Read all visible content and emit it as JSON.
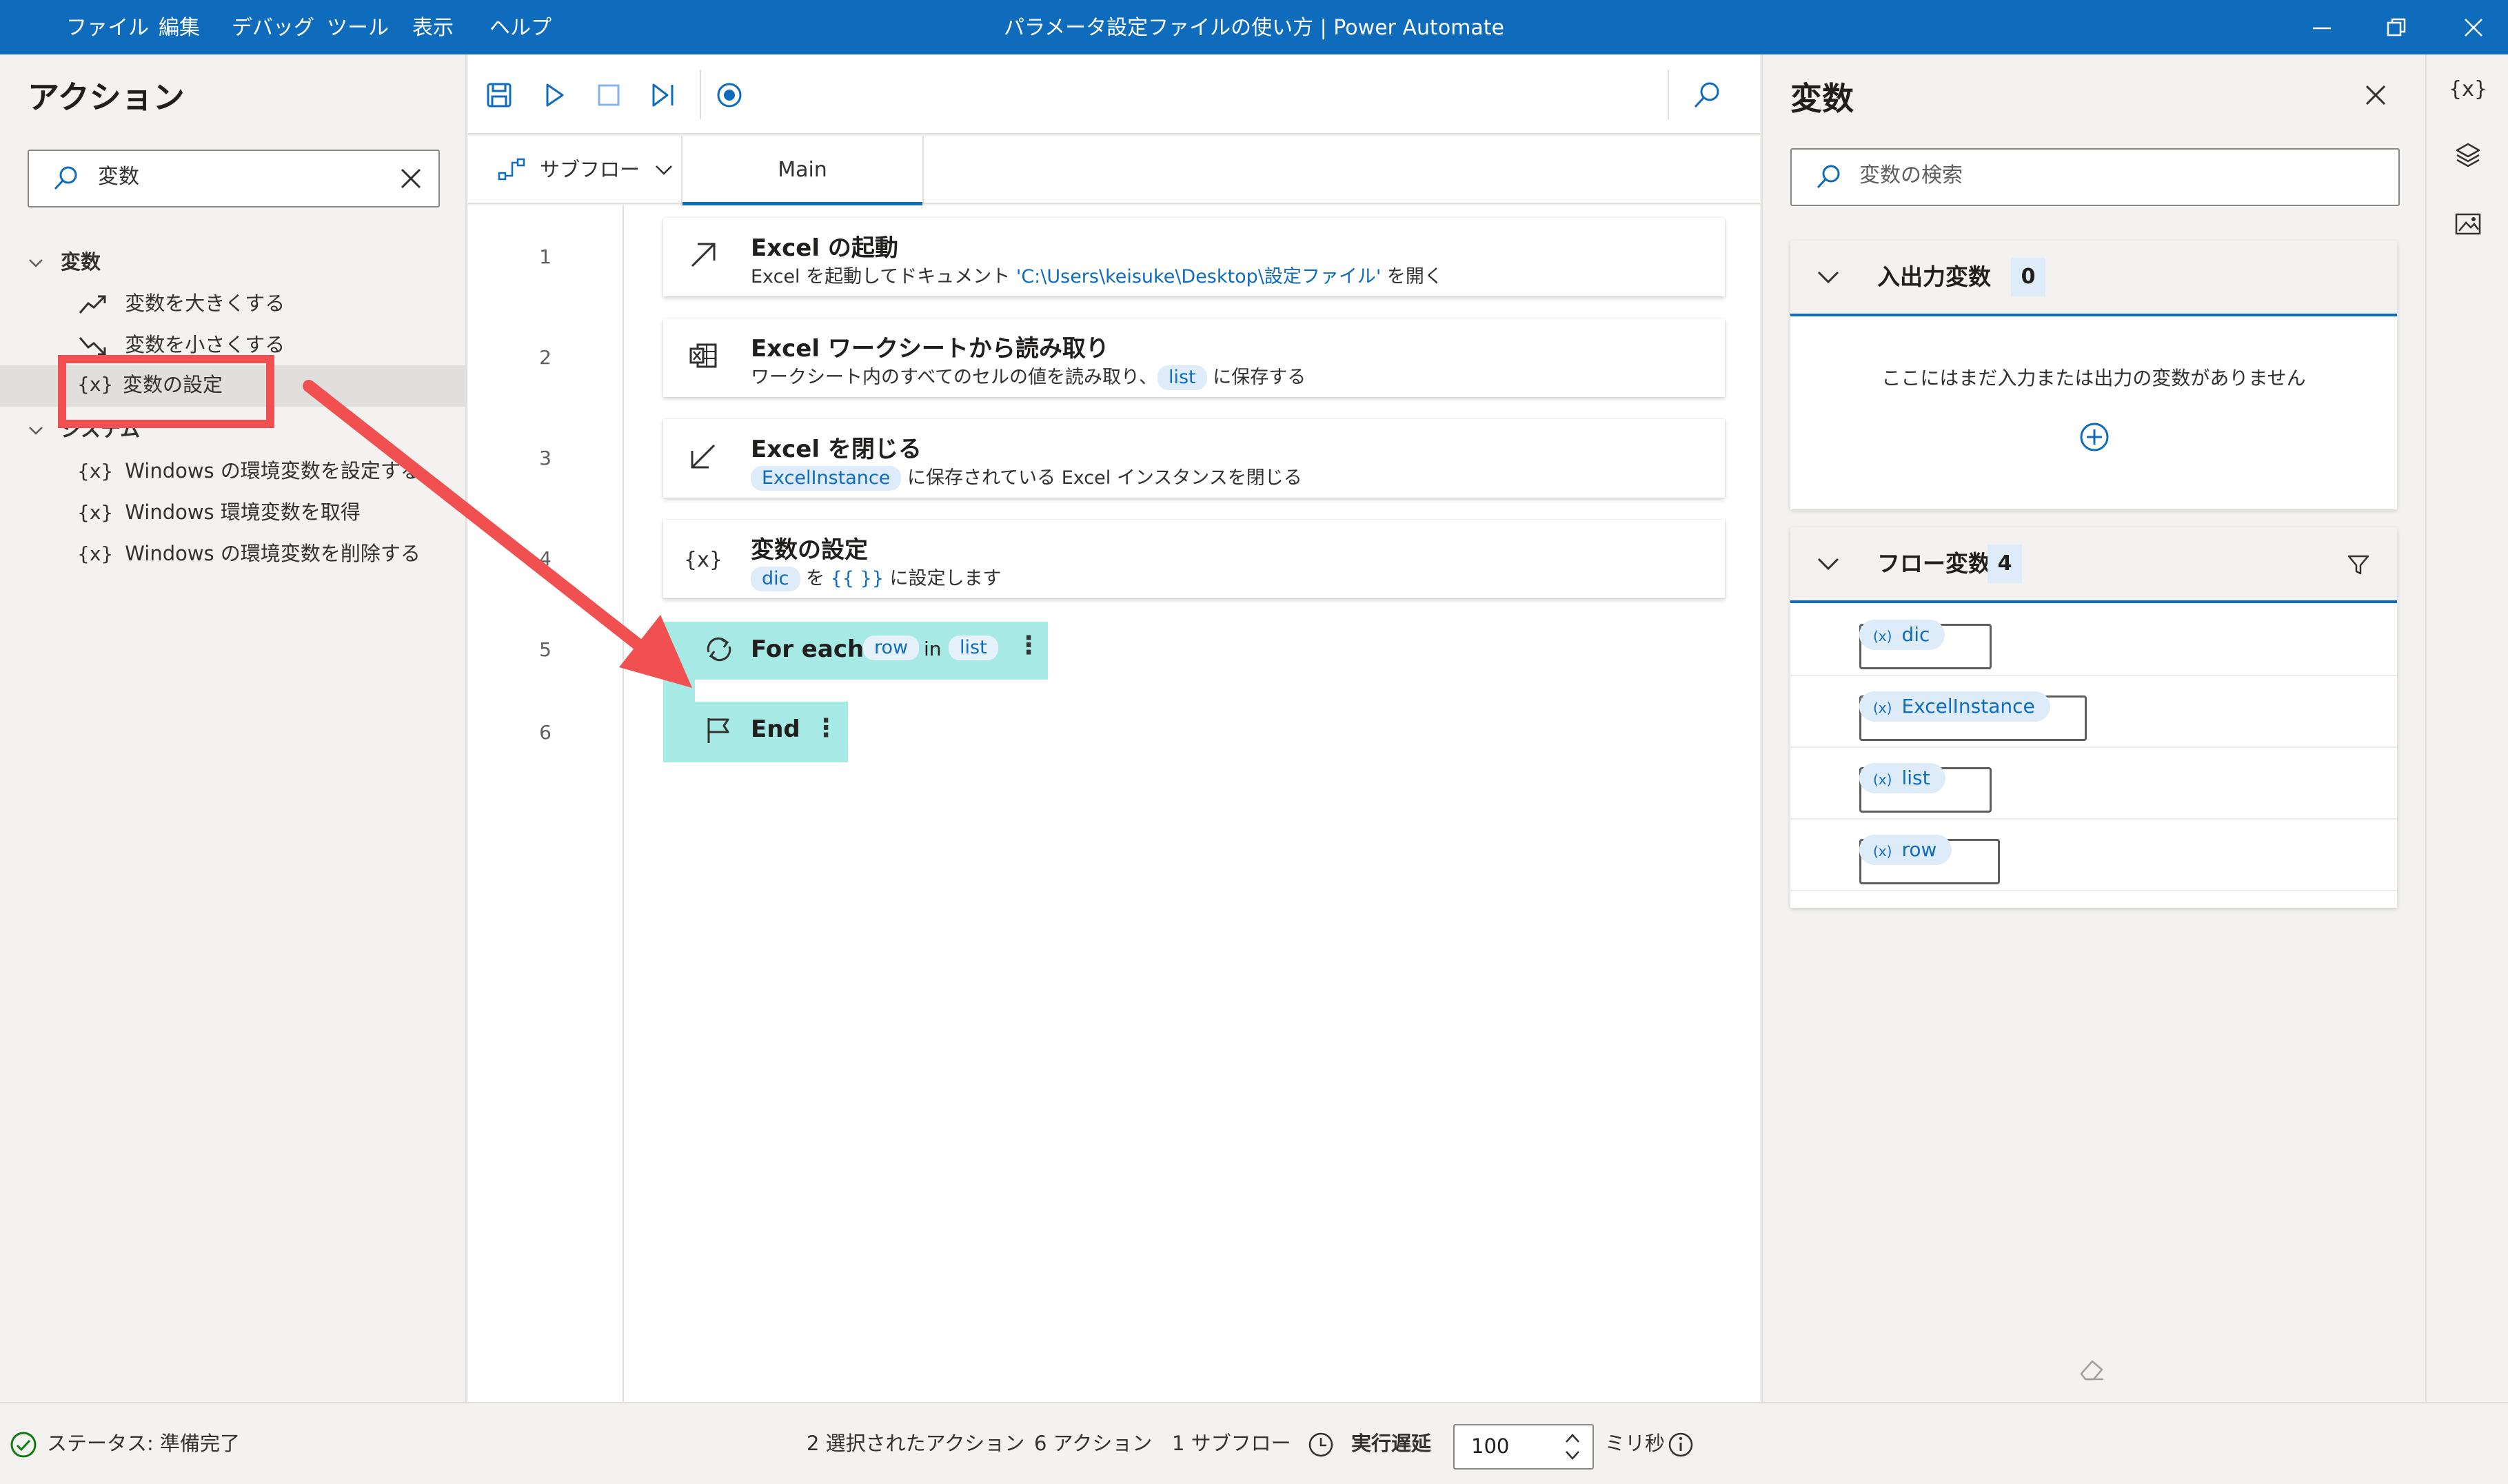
{
  "window": {
    "title": "パラメータ設定ファイルの使い方 | Power Automate",
    "menu": [
      "ファイル",
      "編集",
      "デバッグ",
      "ツール",
      "表示",
      "ヘルプ"
    ]
  },
  "actions_panel": {
    "title": "アクション",
    "search": {
      "value": "変数"
    },
    "groups": [
      {
        "label": "変数",
        "items": [
          {
            "icon": "trend-up-icon",
            "label": "変数を大きくする"
          },
          {
            "icon": "trend-down-icon",
            "label": "変数を小さくする"
          },
          {
            "icon": "{x}",
            "label": "変数の設定",
            "selected": true
          }
        ]
      },
      {
        "label": "システム",
        "items": [
          {
            "icon": "{x}",
            "label": "Windows の環境変数を設定する"
          },
          {
            "icon": "{x}",
            "label": "Windows 環境変数を取得"
          },
          {
            "icon": "{x}",
            "label": "Windows の環境変数を削除する"
          }
        ]
      }
    ]
  },
  "designer": {
    "subflow_label": "サブフロー",
    "active_tab": "Main",
    "line_numbers": [
      "1",
      "2",
      "3",
      "4",
      "5",
      "6"
    ],
    "steps": [
      {
        "title": "Excel の起動",
        "desc_pre": "Excel を起動してドキュメント ",
        "desc_link": "'C:\\Users\\keisuke\\Desktop\\設定ファイル'",
        "desc_post": " を開く"
      },
      {
        "title": "Excel ワークシートから読み取り",
        "desc_pre": "ワークシート内のすべてのセルの値を読み取り、",
        "desc_var": "list",
        "desc_post": " に保存する"
      },
      {
        "title": "Excel を閉じる",
        "desc_var": "ExcelInstance",
        "desc_post": " に保存されている Excel インスタンスを閉じる"
      },
      {
        "icon": "{x}",
        "title": "変数の設定",
        "desc_var": "dic",
        "desc_mid": " を ",
        "desc_link": "{{ }}",
        "desc_post": " に設定します"
      }
    ],
    "foreach": {
      "label": "For each",
      "var": "row",
      "in": "in",
      "list": "list",
      "menu": "⋮"
    },
    "end": {
      "label": "End",
      "menu": "⋮"
    }
  },
  "variables_panel": {
    "title": "変数",
    "search_placeholder": "変数の検索",
    "io": {
      "title": "入出力変数",
      "count": "0",
      "empty_text": "ここにはまだ入力または出力の変数がありません"
    },
    "flow": {
      "title": "フロー変数",
      "count": "4",
      "prefix": "(x)",
      "vars": [
        "dic",
        "ExcelInstance",
        "list",
        "row"
      ]
    }
  },
  "rail": {
    "variables_label": "{x}"
  },
  "statusbar": {
    "status": "ステータス: 準備完了",
    "selected": "2 選択されたアクション",
    "actions": "6 アクション",
    "subflows": "1 サブフロー",
    "delay_label": "実行遅延",
    "delay_value": "100",
    "unit": "ミリ秒"
  },
  "colors": {
    "titlebar": "#0f6cbd",
    "accent": "#0f6cbd",
    "loop_block": "#a6e9e5",
    "annotation": "#f05050"
  }
}
